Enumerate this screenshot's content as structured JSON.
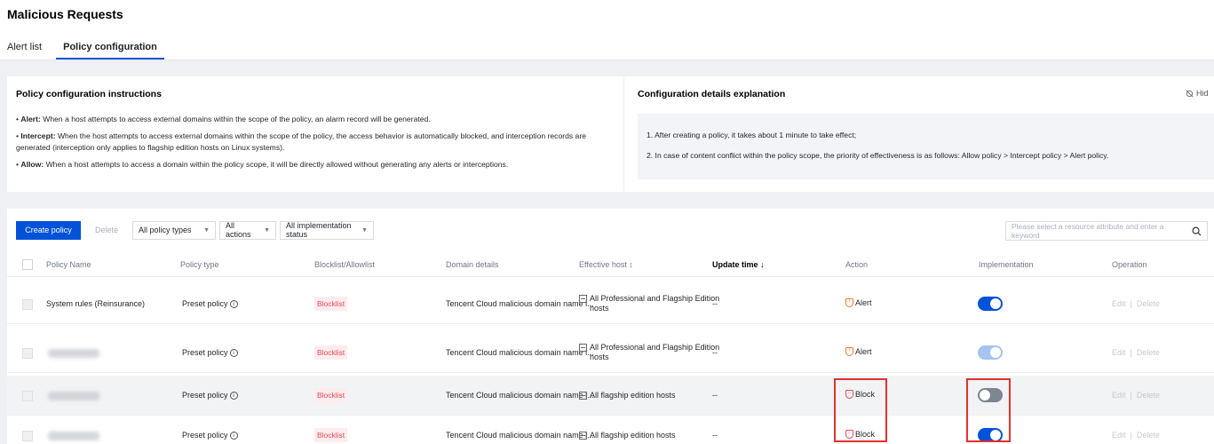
{
  "page": {
    "title": "Malicious Requests",
    "tabs": [
      {
        "label": "Alert list",
        "active": false
      },
      {
        "label": "Policy configuration",
        "active": true
      }
    ]
  },
  "instructions": {
    "title": "Policy configuration instructions",
    "items": [
      {
        "term": "Alert:",
        "text": " When a host attempts to access external domains within the scope of the policy, an alarm record will be generated."
      },
      {
        "term": "Intercept:",
        "text": " When the host attempts to access external domains within the scope of the policy, the access behavior is automatically blocked, and interception records are generated (interception only applies to flagship edition hosts on Linux systems)."
      },
      {
        "term": "Allow:",
        "text": " When a host attempts to access a domain within the policy scope, it will be directly allowed without generating any alerts or interceptions."
      }
    ]
  },
  "explanation": {
    "title": "Configuration details explanation",
    "hide_label": "Hid",
    "items": [
      "1. After creating a policy, it takes about 1 minute to take effect;",
      "2. In case of content conflict within the policy scope, the priority of effectiveness is as follows: Allow policy > Intercept policy > Alert policy."
    ]
  },
  "toolbar": {
    "create_label": "Create policy",
    "delete_label": "Delete",
    "filters": [
      "All policy types",
      "All actions",
      "All implementation status"
    ],
    "search_placeholder": "Please select a resource attribute and enter a keyword"
  },
  "table": {
    "columns": {
      "name": "Policy Name",
      "type": "Policy type",
      "list": "Blocklist/Allowlist",
      "domain": "Domain details",
      "host": "Effective host ↕",
      "update": "Update time ↓",
      "action": "Action",
      "impl": "Implementation",
      "op": "Operation"
    },
    "rows": [
      {
        "name": "System rules (Reinsurance)",
        "name_hidden": false,
        "type": "Preset policy",
        "list": "Blocklist",
        "domain": "Tencent Cloud malicious domain name l...",
        "host_line1": "All Professional and Flagship Edition",
        "host_line2": "hosts",
        "update": "--",
        "action": "Alert",
        "impl_state": "on",
        "edit": "Edit",
        "delete": "Delete"
      },
      {
        "name": "",
        "name_hidden": true,
        "type": "Preset policy",
        "list": "Blocklist",
        "domain": "Tencent Cloud malicious domain name l...",
        "host_line1": "All Professional and Flagship Edition",
        "host_line2": "hosts",
        "update": "--",
        "action": "Alert",
        "impl_state": "on-disabled",
        "edit": "Edit",
        "delete": "Delete"
      },
      {
        "name": "",
        "name_hidden": true,
        "type": "Preset policy",
        "list": "Blocklist",
        "domain": "Tencent Cloud malicious domain name l...",
        "host_line1": "All flagship edition hosts",
        "host_line2": "",
        "update": "--",
        "action": "Block",
        "impl_state": "off",
        "edit": "Edit",
        "delete": "Delete"
      },
      {
        "name": "",
        "name_hidden": true,
        "type": "Preset policy",
        "list": "Blocklist",
        "domain": "Tencent Cloud malicious domain name l...",
        "host_line1": "All flagship edition hosts",
        "host_line2": "",
        "update": "--",
        "action": "Block",
        "impl_state": "on",
        "edit": "Edit",
        "delete": "Delete"
      }
    ]
  },
  "colors": {
    "primary": "#0052d9",
    "blocklist_tag": "#e34d59",
    "alert_icon": "#ed7b2f",
    "highlight_box": "#e0322f"
  }
}
